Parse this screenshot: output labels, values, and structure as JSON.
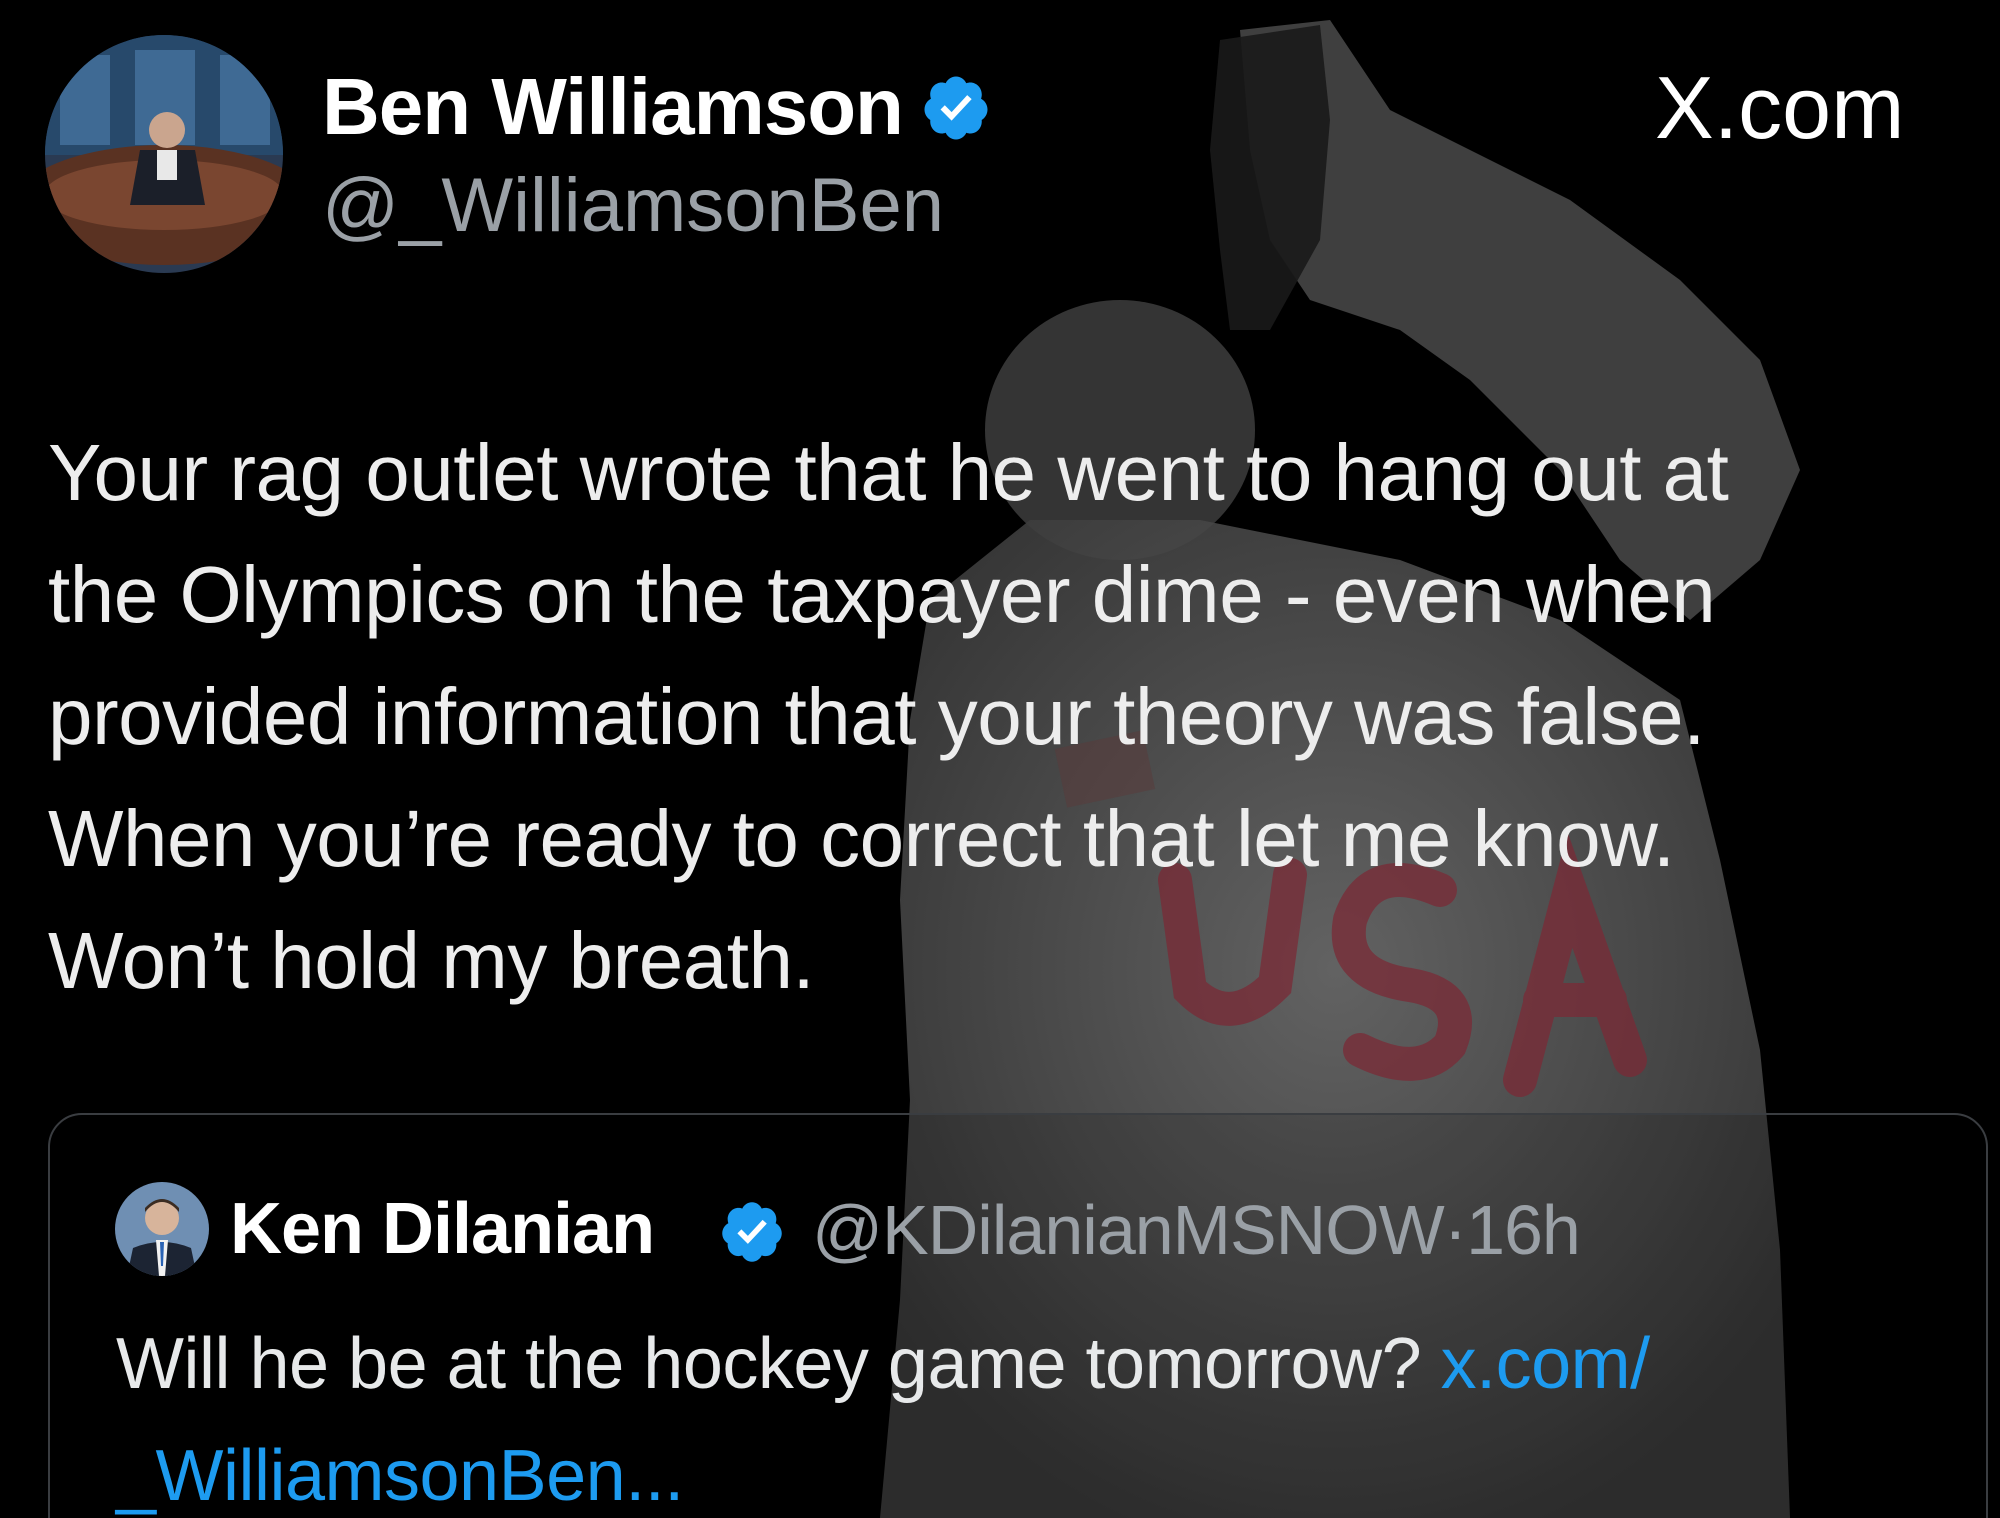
{
  "author": {
    "display_name": "Ben Williamson",
    "handle": "@_WilliamsonBen",
    "verified_icon": "verified-badge-icon",
    "avatar_icon": "profile-photo"
  },
  "brand_label": "X.com",
  "tweet": {
    "lines": [
      "Your rag outlet wrote that he went to hang out at",
      "the Olympics on the taxpayer dime - even when",
      "provided information that your theory was false.",
      "When you’re ready to correct that let me know.",
      "Won’t hold my breath."
    ]
  },
  "quoted_tweet": {
    "display_name": "Ken Dilanian",
    "handle": "@KDilanianMSNOW",
    "separator": "·",
    "time": "16h",
    "text_line1": "Will he be at the hockey game tomorrow? ",
    "link_part1": "x.com/",
    "link_part2": "_WilliamsonBen..."
  },
  "colors": {
    "background": "#000000",
    "text": "#e7e9ea",
    "secondary_text": "#9aa0a6",
    "link": "#1d9bf0",
    "verified": "#1d9bf0"
  }
}
